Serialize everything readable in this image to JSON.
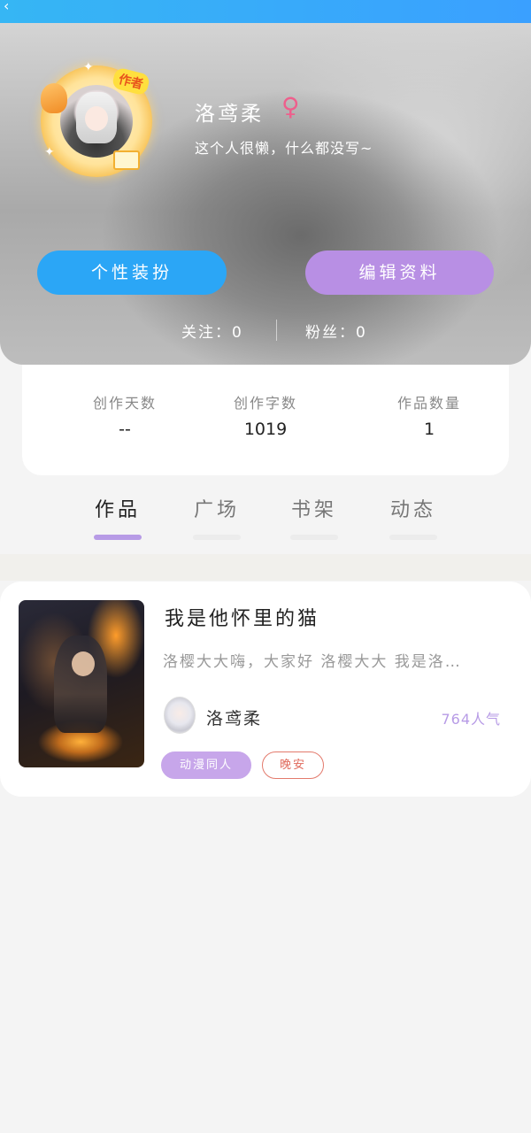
{
  "colors": {
    "accent_blue": "#2ba6f6",
    "accent_purple": "#b88fe4",
    "gender_pink": "#ee5f8c",
    "tag_outline_red": "#e37a6c"
  },
  "header": {
    "back_icon": "chevron-left-icon",
    "author_badge": "作者",
    "nickname": "洛鸢柔",
    "gender_icon": "♀",
    "bio": "这个人很懒，什么都没写~",
    "buttons": {
      "style": "个性装扮",
      "edit": "编辑资料"
    },
    "follow": {
      "following": "关注：0",
      "fans": "粉丝：0"
    }
  },
  "stats": [
    {
      "label": "创作天数",
      "value": "--"
    },
    {
      "label": "创作字数",
      "value": "1019"
    },
    {
      "label": "作品数量",
      "value": "1"
    }
  ],
  "tabs": [
    {
      "label": "作品",
      "active": true
    },
    {
      "label": "广场",
      "active": false
    },
    {
      "label": "书架",
      "active": false
    },
    {
      "label": "动态",
      "active": false
    }
  ],
  "work": {
    "title": "我是他怀里的猫",
    "summary": "洛樱大大嗨，大家好 洛樱大大 我是洛…",
    "author": "洛鸢柔",
    "popularity": "764人气",
    "tags": [
      "动漫同人",
      "晚安"
    ]
  }
}
